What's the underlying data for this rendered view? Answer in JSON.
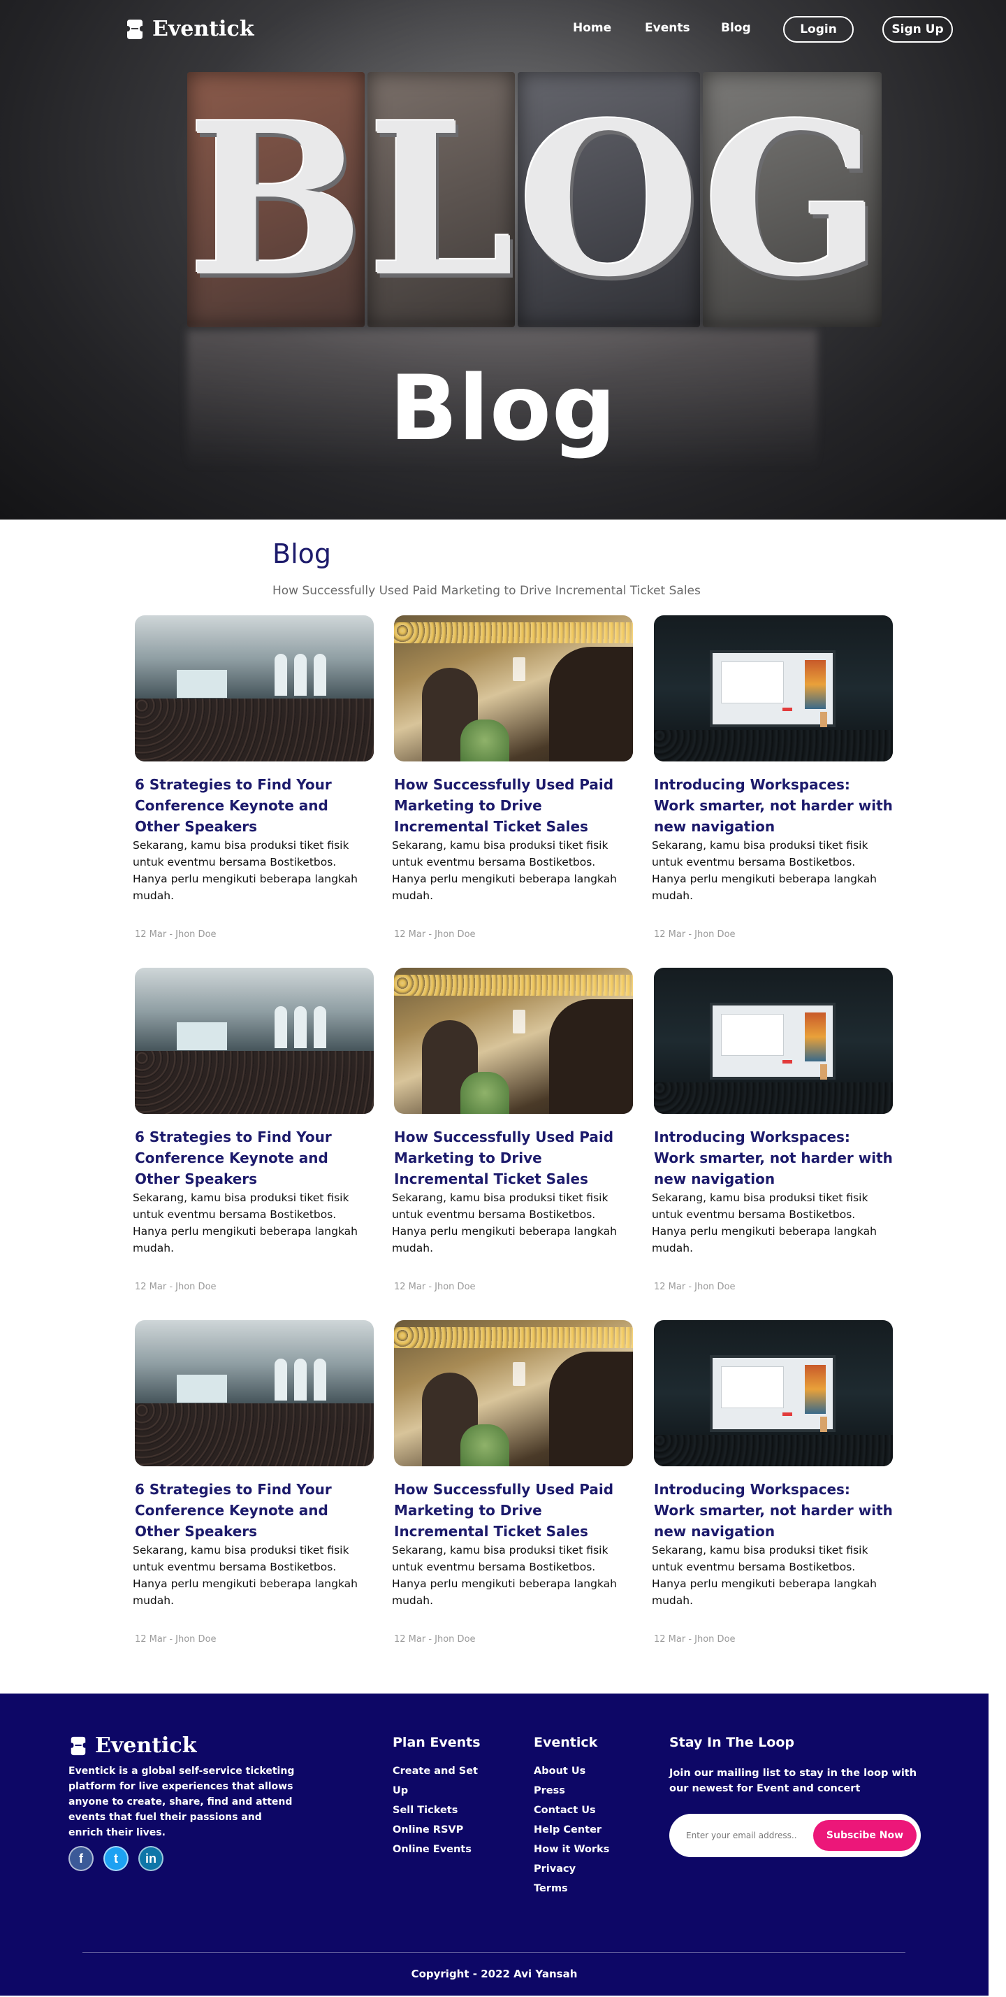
{
  "nav": {
    "brand": "Eventick",
    "links": [
      "Home",
      "Events",
      "Blog"
    ],
    "login": "Login",
    "signup": "Sign Up"
  },
  "hero": {
    "blocks": [
      "B",
      "L",
      "O",
      "G"
    ],
    "title": "Blog"
  },
  "blog": {
    "heading": "Blog",
    "subheading": "How Successfully Used Paid Marketing to Drive Incremental Ticket Sales"
  },
  "cards": [
    {
      "image": "conference-hall-photo",
      "title": "6 Strategies to Find Your Conference Keynote and Other Speakers",
      "desc": "Sekarang, kamu bisa produksi tiket fisik untuk eventmu bersama Bostiketbos. Hanya perlu mengikuti beberapa langkah mudah.",
      "meta": "12 Mar - Jhon Doe"
    },
    {
      "image": "party-toast-photo",
      "title": "How Successfully Used Paid Marketing to Drive Incremental Ticket Sales",
      "desc": "Sekarang, kamu bisa produksi tiket fisik untuk eventmu bersama Bostiketbos. Hanya perlu mengikuti beberapa langkah mudah.",
      "meta": "12 Mar - Jhon Doe"
    },
    {
      "image": "stage-presentation-photo",
      "title": "Introducing Workspaces: Work smarter, not harder with new navigation",
      "desc": "Sekarang, kamu bisa produksi tiket fisik untuk eventmu bersama Bostiketbos. Hanya perlu mengikuti beberapa langkah mudah.",
      "meta": "12 Mar - Jhon Doe"
    },
    {
      "image": "conference-hall-photo",
      "title": "6 Strategies to Find Your Conference Keynote and Other Speakers",
      "desc": "Sekarang, kamu bisa produksi tiket fisik untuk eventmu bersama Bostiketbos. Hanya perlu mengikuti beberapa langkah mudah.",
      "meta": "12 Mar - Jhon Doe"
    },
    {
      "image": "party-toast-photo",
      "title": "How Successfully Used Paid Marketing to Drive Incremental Ticket Sales",
      "desc": "Sekarang, kamu bisa produksi tiket fisik untuk eventmu bersama Bostiketbos. Hanya perlu mengikuti beberapa langkah mudah.",
      "meta": "12 Mar - Jhon Doe"
    },
    {
      "image": "stage-presentation-photo",
      "title": "Introducing Workspaces: Work smarter, not harder with new navigation",
      "desc": "Sekarang, kamu bisa produksi tiket fisik untuk eventmu bersama Bostiketbos. Hanya perlu mengikuti beberapa langkah mudah.",
      "meta": "12 Mar - Jhon Doe"
    },
    {
      "image": "conference-hall-photo",
      "title": "6 Strategies to Find Your Conference Keynote and Other Speakers",
      "desc": "Sekarang, kamu bisa produksi tiket fisik untuk eventmu bersama Bostiketbos. Hanya perlu mengikuti beberapa langkah mudah.",
      "meta": "12 Mar - Jhon Doe"
    },
    {
      "image": "party-toast-photo",
      "title": "How Successfully Used Paid Marketing to Drive Incremental Ticket Sales",
      "desc": "Sekarang, kamu bisa produksi tiket fisik untuk eventmu bersama Bostiketbos. Hanya perlu mengikuti beberapa langkah mudah.",
      "meta": "12 Mar - Jhon Doe"
    },
    {
      "image": "stage-presentation-photo",
      "title": "Introducing Workspaces: Work smarter, not harder with new navigation",
      "desc": "Sekarang, kamu bisa produksi tiket fisik untuk eventmu bersama Bostiketbos. Hanya perlu mengikuti beberapa langkah mudah.",
      "meta": "12 Mar - Jhon Doe"
    }
  ],
  "footer": {
    "brand": "Eventick",
    "about": "Eventick is a global self-service ticketing platform for live experiences that allows anyone to create, share, find and attend events that fuel their passions and enrich their lives.",
    "socials": [
      {
        "icon": "facebook-icon",
        "glyph": "f"
      },
      {
        "icon": "twitter-icon",
        "glyph": "t"
      },
      {
        "icon": "linkedin-icon",
        "glyph": "in"
      }
    ],
    "plan_title": "Plan Events",
    "plan_links": [
      "Create and Set Up",
      "Sell Tickets",
      "Online RSVP",
      "Online Events"
    ],
    "brand_title": "Eventick",
    "brand_links": [
      "About Us",
      "Press",
      "Contact Us",
      "Help Center",
      "How it Works",
      "Privacy",
      "Terms"
    ],
    "loop_title": "Stay In The Loop",
    "loop_text": "Join our mailing list to stay in the loop with our newest for Event and concert",
    "email_placeholder": "Enter your email address..",
    "subscribe_label": "Subscibe Now",
    "copyright": "Copyright - 2022 Avi Yansah"
  },
  "colors": {
    "brand_navy": "#1c1a6b",
    "footer_bg": "#0d0766",
    "accent_pink": "#ec1779"
  }
}
